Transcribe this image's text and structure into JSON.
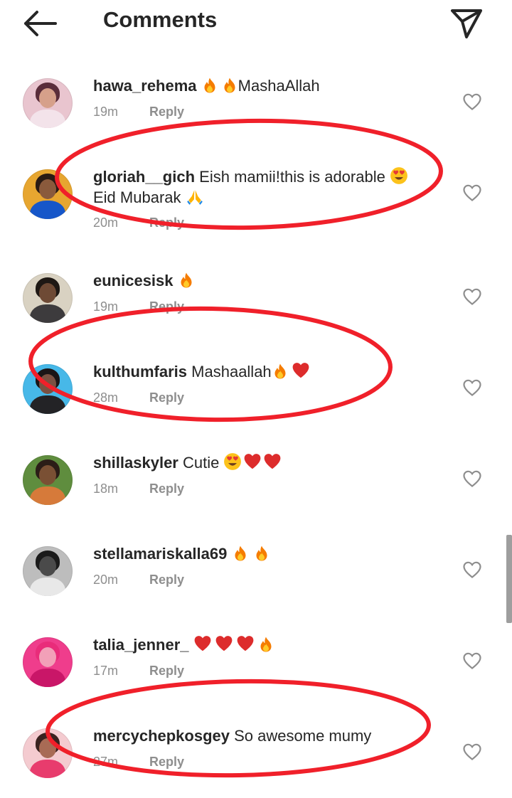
{
  "header": {
    "title": "Comments",
    "back_icon": "arrow-left-icon",
    "send_icon": "paper-plane-icon"
  },
  "comments": [
    {
      "username": "hawa_rehema",
      "text": "MashaAllah",
      "time": "19m",
      "reply": "Reply",
      "avatar_colors": [
        "#e9c5cf",
        "#5a2d3a",
        "#d6a08a",
        "#f3e3ea"
      ]
    },
    {
      "username": "gloriah__gich",
      "text": "Eish mamii!this is adorable",
      "text_line2": "Eid Mubarak",
      "time": "20m",
      "reply": "Reply",
      "avatar_colors": [
        "#e7a630",
        "#2a1b14",
        "#8a5a3c",
        "#1656c9"
      ]
    },
    {
      "username": "eunicesisk",
      "text": "",
      "time": "19m",
      "reply": "Reply",
      "avatar_colors": [
        "#d9d2c2",
        "#1e1814",
        "#6e4a35",
        "#3d3b3d"
      ]
    },
    {
      "username": "kulthumfaris",
      "text": "Mashaallah",
      "time": "28m",
      "reply": "Reply",
      "avatar_colors": [
        "#47b8e8",
        "#1b1516",
        "#7b5142",
        "#232326"
      ]
    },
    {
      "username": "shillaskyler",
      "text": "Cutie",
      "time": "18m",
      "reply": "Reply",
      "avatar_colors": [
        "#5f8d3e",
        "#2b1d17",
        "#7a5034",
        "#d67a3a"
      ]
    },
    {
      "username": "stellamariskalla69",
      "text": "",
      "time": "20m",
      "reply": "Reply",
      "avatar_colors": [
        "#bdbdbd",
        "#1b1b1b",
        "#4a4a4a",
        "#e8e8e8"
      ]
    },
    {
      "username": "talia_jenner_",
      "text": "",
      "time": "17m",
      "reply": "Reply",
      "avatar_colors": [
        "#ef3d8c",
        "#e92c7a",
        "#f2a0b8",
        "#c91668"
      ]
    },
    {
      "username": "mercychepkosgey",
      "text": "So awesome mumy",
      "time": "27m",
      "reply": "Reply",
      "avatar_colors": [
        "#f4cbd0",
        "#3a2320",
        "#a86b55",
        "#e83c6d"
      ]
    }
  ],
  "colors": {
    "annotation_red": "#f0202a",
    "meta_gray": "#8e8e8e",
    "text": "#262626"
  }
}
